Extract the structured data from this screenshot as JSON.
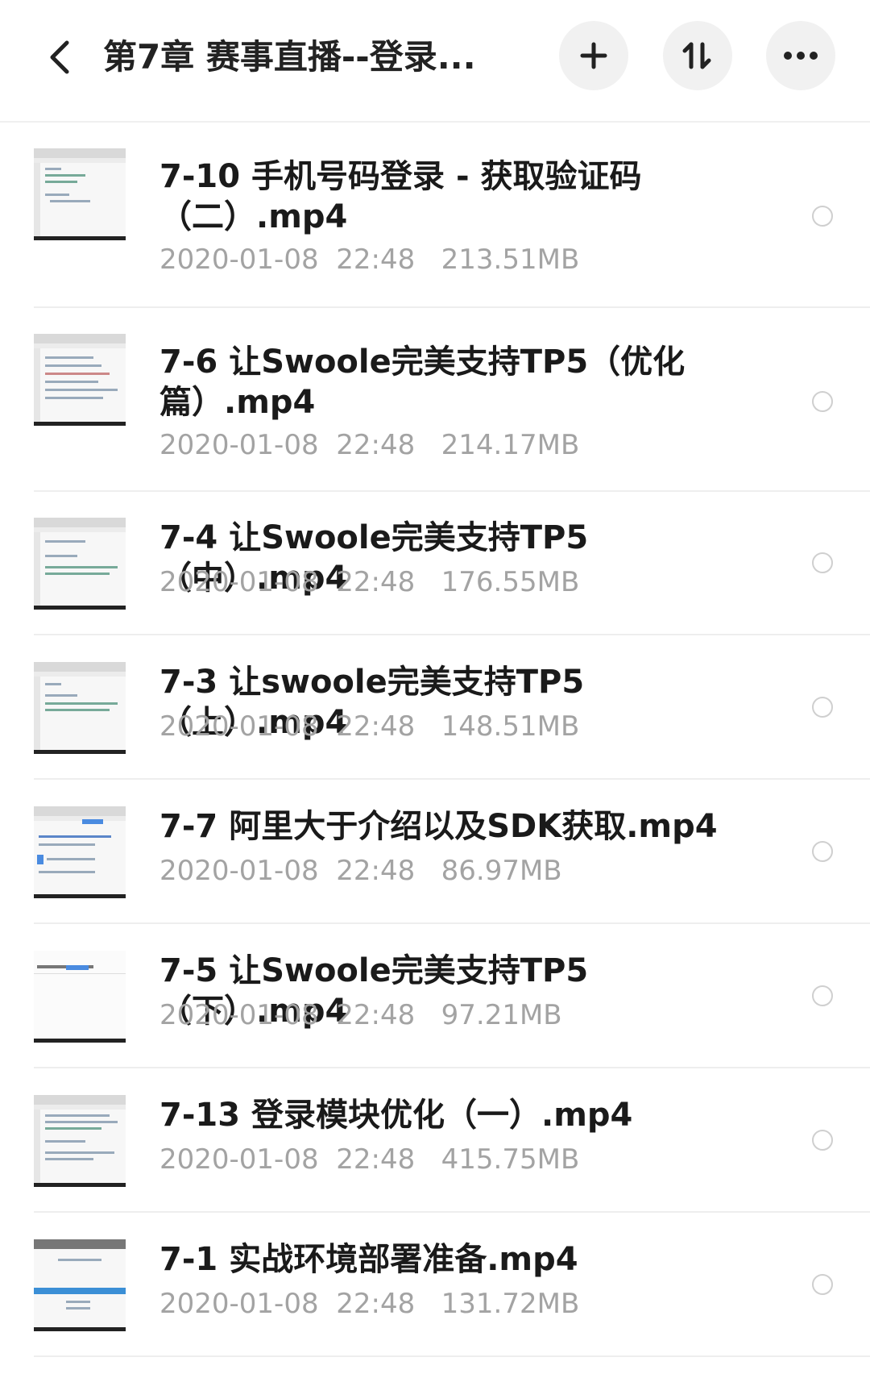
{
  "header": {
    "title": "第7章 赛事直播--登录...",
    "back_icon": "chevron-left-icon",
    "add_icon": "plus-icon",
    "sort_icon": "sort-icon",
    "more_icon": "more-icon"
  },
  "files": [
    {
      "name": "7-10 手机号码登录 - 获取验证码（二）.mp4",
      "date": "2020-01-08",
      "time": "22:48",
      "size": "213.51MB"
    },
    {
      "name": "7-6 让Swoole完美支持TP5（优化篇）.mp4",
      "date": "2020-01-08",
      "time": "22:48",
      "size": "214.17MB"
    },
    {
      "name": "7-4 让Swoole完美支持TP5（中）.mp4",
      "date": "2020-01-08",
      "time": "22:48",
      "size": "176.55MB"
    },
    {
      "name": "7-3 让swoole完美支持TP5（上）.mp4",
      "date": "2020-01-08",
      "time": "22:48",
      "size": "148.51MB"
    },
    {
      "name": "7-7 阿里大于介绍以及SDK获取.mp4",
      "date": "2020-01-08",
      "time": "22:48",
      "size": "86.97MB"
    },
    {
      "name": "7-5 让Swoole完美支持TP5（下）.mp4",
      "date": "2020-01-08",
      "time": "22:48",
      "size": "97.21MB"
    },
    {
      "name": "7-13 登录模块优化（一）.mp4",
      "date": "2020-01-08",
      "time": "22:48",
      "size": "415.75MB"
    },
    {
      "name": "7-1 实战环境部署准备.mp4",
      "date": "2020-01-08",
      "time": "22:48",
      "size": "131.72MB"
    }
  ]
}
